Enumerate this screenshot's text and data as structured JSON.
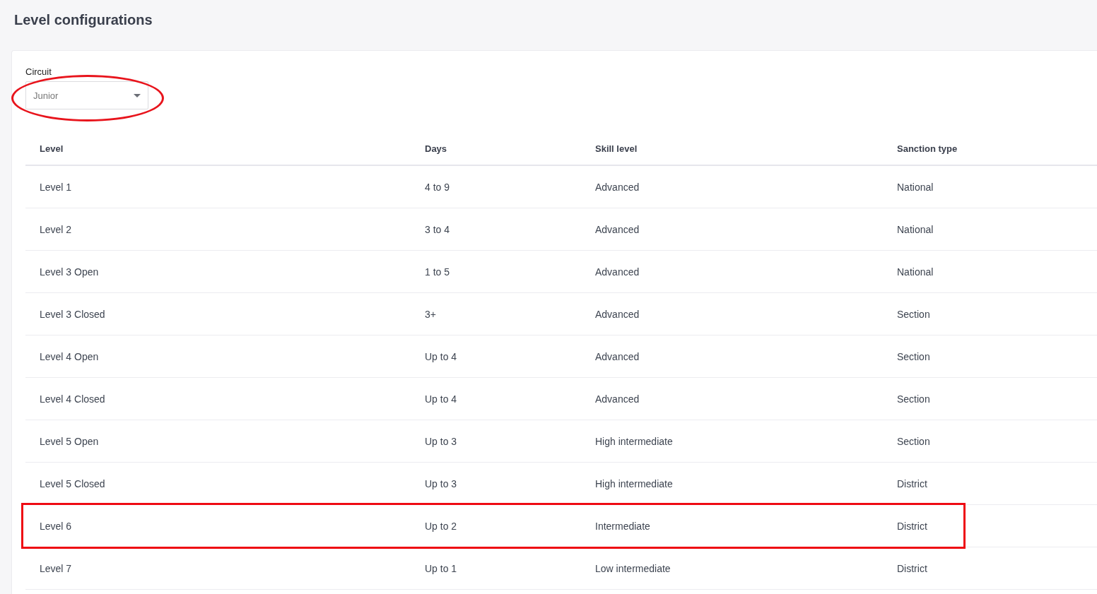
{
  "page_title": "Level configurations",
  "circuit": {
    "label": "Circuit",
    "value": "Junior",
    "highlighted": true
  },
  "table": {
    "columns": [
      "Level",
      "Days",
      "Skill level",
      "Sanction type"
    ],
    "rows": [
      {
        "cells": [
          "Level 1",
          "4 to 9",
          "Advanced",
          "National"
        ],
        "highlighted": false
      },
      {
        "cells": [
          "Level 2",
          "3 to 4",
          "Advanced",
          "National"
        ],
        "highlighted": false
      },
      {
        "cells": [
          "Level 3 Open",
          "1 to 5",
          "Advanced",
          "National"
        ],
        "highlighted": false
      },
      {
        "cells": [
          "Level 3 Closed",
          "3+",
          "Advanced",
          "Section"
        ],
        "highlighted": false
      },
      {
        "cells": [
          "Level 4 Open",
          "Up to 4",
          "Advanced",
          "Section"
        ],
        "highlighted": false
      },
      {
        "cells": [
          "Level 4 Closed",
          "Up to 4",
          "Advanced",
          "Section"
        ],
        "highlighted": false
      },
      {
        "cells": [
          "Level 5 Open",
          "Up to 3",
          "High intermediate",
          "Section"
        ],
        "highlighted": false
      },
      {
        "cells": [
          "Level 5 Closed",
          "Up to 3",
          "High intermediate",
          "District"
        ],
        "highlighted": false
      },
      {
        "cells": [
          "Level 6",
          "Up to 2",
          "Intermediate",
          "District"
        ],
        "highlighted": true
      },
      {
        "cells": [
          "Level 7",
          "Up to 1",
          "Low intermediate",
          "District"
        ],
        "highlighted": false
      }
    ]
  }
}
